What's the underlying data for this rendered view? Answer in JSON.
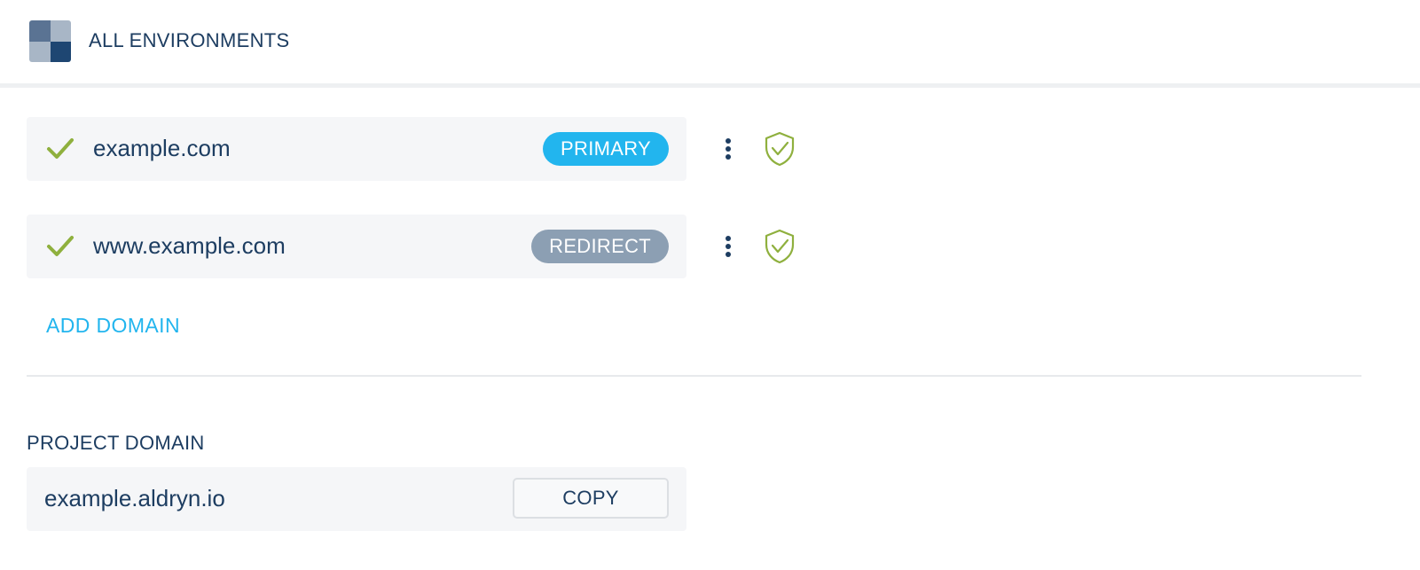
{
  "header": {
    "title": "ALL ENVIRONMENTS",
    "logo_icon": "environments-grid-icon"
  },
  "domains": [
    {
      "name": "example.com",
      "badge": "PRIMARY",
      "badge_color": "#22b5ee",
      "status_icon": "check-icon",
      "ssl_icon": "shield-check-icon",
      "menu_icon": "kebab-menu-icon"
    },
    {
      "name": "www.example.com",
      "badge": "REDIRECT",
      "badge_color": "#8c9fb3",
      "status_icon": "check-icon",
      "ssl_icon": "shield-check-icon",
      "menu_icon": "kebab-menu-icon"
    }
  ],
  "add_domain_label": "ADD DOMAIN",
  "project_domain": {
    "label": "PROJECT DOMAIN",
    "value": "example.aldryn.io",
    "copy_label": "COPY"
  },
  "colors": {
    "text": "#1d3d61",
    "accent": "#22b5ee",
    "success": "#8fb03e",
    "row_background": "#f5f6f8"
  }
}
